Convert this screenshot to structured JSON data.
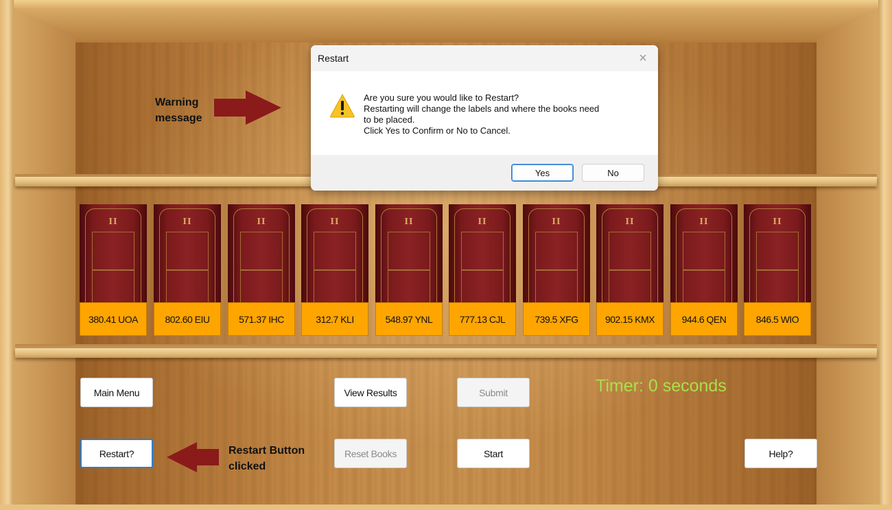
{
  "dialog": {
    "title": "Restart",
    "close_glyph": "×",
    "message_lines": [
      "Are you sure you would like to Restart?",
      "Restarting will change the labels and where the books need",
      "to be placed.",
      "Click Yes to Confirm or No to Cancel."
    ],
    "yes_label": "Yes",
    "no_label": "No",
    "icon": "warning-icon"
  },
  "annotations": {
    "warning_line1": "Warning",
    "warning_line2": "message",
    "restart_line1": "Restart Button",
    "restart_line2": "clicked",
    "arrow_color": "#8b1a1a"
  },
  "books": [
    {
      "label": "380.41 UOA"
    },
    {
      "label": "802.60 EIU"
    },
    {
      "label": "571.37 IHC"
    },
    {
      "label": "312.7 KLI"
    },
    {
      "label": "548.97 YNL"
    },
    {
      "label": "777.13 CJL"
    },
    {
      "label": "739.5 XFG"
    },
    {
      "label": "902.15 KMX"
    },
    {
      "label": "944.6 QEN"
    },
    {
      "label": "846.5 WIO"
    }
  ],
  "book_roman": "II",
  "buttons": {
    "main_menu": "Main Menu",
    "view_results": "View Results",
    "submit": "Submit",
    "restart": "Restart?",
    "reset_books": "Reset Books",
    "start": "Start",
    "help": "Help?"
  },
  "timer": "Timer: 0 seconds",
  "colors": {
    "label_bg": "#ffa500",
    "timer": "#a8e04a",
    "focus_border": "#2b7fd0"
  }
}
